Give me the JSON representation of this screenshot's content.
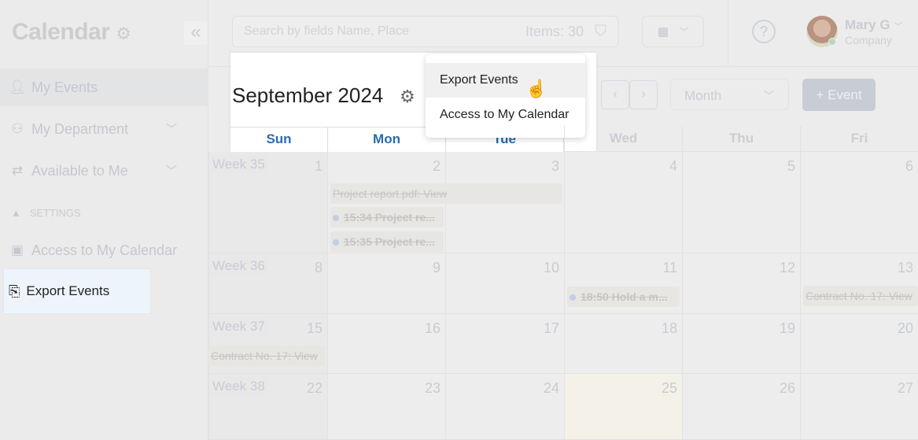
{
  "sidebar": {
    "title": "Calendar",
    "collapse_icon": "double-chevron-left",
    "items": [
      {
        "label": "My Events",
        "icon": "user-icon"
      },
      {
        "label": "My Department",
        "icon": "users-icon"
      },
      {
        "label": "Available to Me",
        "icon": "arrows-icon"
      }
    ],
    "section": "SETTINGS",
    "settings": [
      {
        "label": "Access to My Calendar",
        "icon": "calendar-check-icon"
      },
      {
        "label": "Export Events",
        "icon": "file-export-icon"
      }
    ]
  },
  "topbar": {
    "search_placeholder": "Search by fields Name, Place",
    "items_count": "Items: 30",
    "user_name": "Mary G",
    "user_company": "Company",
    "help": "?"
  },
  "toolbar": {
    "title": "September 2024",
    "view": "Month",
    "add_event": "+ Event",
    "prev": "‹",
    "next": "›"
  },
  "menu": {
    "items": [
      "Export Events",
      "Access to My Calendar"
    ]
  },
  "calendar": {
    "days": [
      "Sun",
      "Mon",
      "Tue",
      "Wed",
      "Thu",
      "Fri"
    ],
    "weeks": [
      {
        "label": "Week 35",
        "dates": [
          "1",
          "2",
          "3",
          "4",
          "5",
          "6"
        ]
      },
      {
        "label": "Week 36",
        "dates": [
          "8",
          "9",
          "10",
          "11",
          "12",
          "13"
        ]
      },
      {
        "label": "Week 37",
        "dates": [
          "15",
          "16",
          "17",
          "18",
          "19",
          "20"
        ]
      },
      {
        "label": "Week 38",
        "dates": [
          "22",
          "23",
          "24",
          "25",
          "26",
          "27"
        ]
      }
    ],
    "events": [
      "Project report.pdf: View",
      "15:34 Project re...",
      "15:35 Project re...",
      "18:50 Hold a m...",
      "Contract No. 17: View",
      "Contract No. 17: View"
    ]
  },
  "colors": {
    "accent": "#2a6bb0",
    "today": "#f4f1e8"
  }
}
